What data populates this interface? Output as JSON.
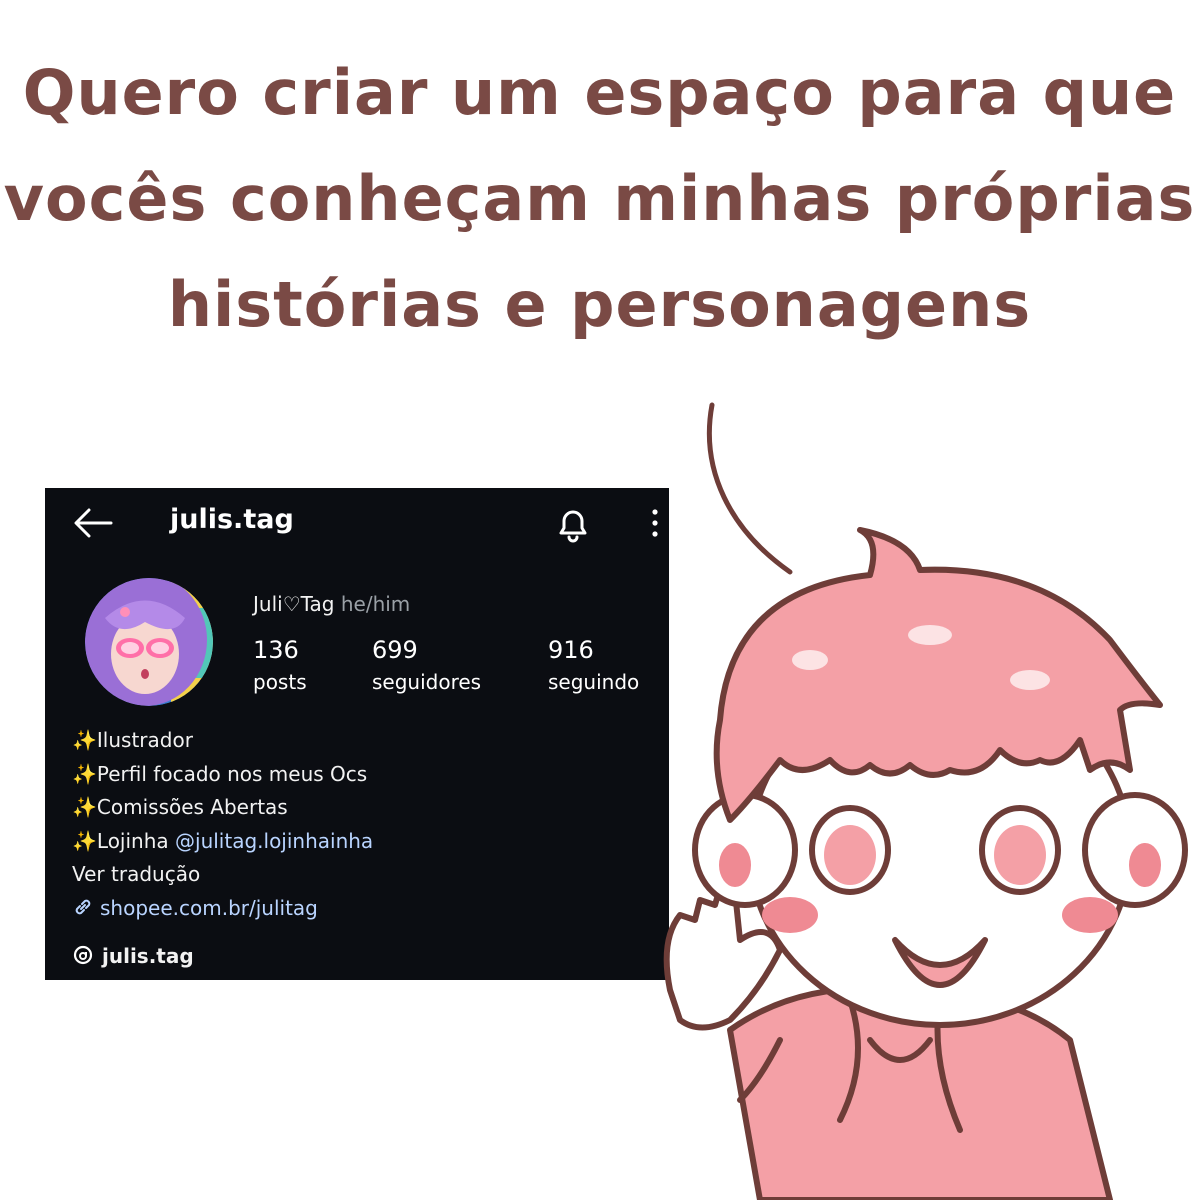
{
  "headline": {
    "line1": "Quero criar um espaço para que",
    "line2": "vocês conheçam minhas próprias",
    "line3": "histórias e personagens"
  },
  "profile": {
    "username": "julis.tag",
    "display_name": "Juli♡Tag",
    "pronouns": "he/him",
    "stats": [
      {
        "value": "136",
        "label": "posts"
      },
      {
        "value": "699",
        "label": "seguidores"
      },
      {
        "value": "916",
        "label": "seguindo"
      }
    ],
    "bio": {
      "line1": "Ilustrador",
      "line2": "Perfil focado nos meus Ocs",
      "line3": "Comissões Abertas",
      "line4_prefix": "Lojinha ",
      "line4_mention": "@julitag.lojinhainha",
      "translate": "Ver tradução",
      "link": "shopee.com.br/julitag",
      "sparkle": "✨"
    },
    "threads_handle": "julis.tag"
  },
  "icons": {
    "back": "arrow-left-icon",
    "bell": "bell-icon",
    "more": "more-vertical-icon",
    "link": "link-icon",
    "threads": "threads-icon"
  },
  "colors": {
    "headline_text": "#7a4a45",
    "panel_bg": "#0b0d12",
    "link": "#b9d4ff",
    "character_pink": "#f4a0a6",
    "character_outline": "#6e3d38"
  }
}
